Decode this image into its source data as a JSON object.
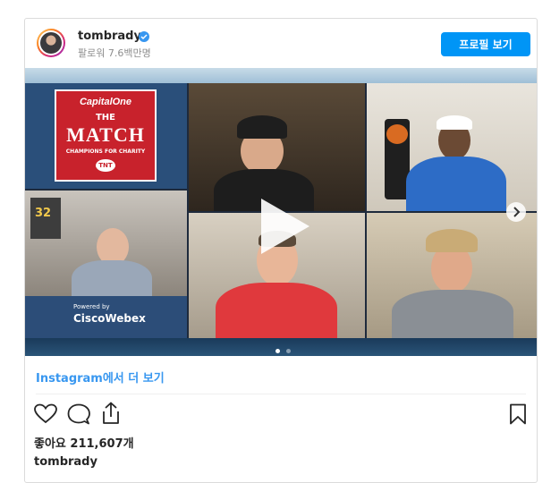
{
  "header": {
    "username": "tombrady",
    "followers": "팔로워 7.6백만명",
    "profile_button": "프로필 보기"
  },
  "media": {
    "sponsor": "CapitalOne",
    "event_the": "THE",
    "event_title": "MATCH",
    "event_subtitle": "CHAMPIONS FOR CHARITY",
    "network": "TNT",
    "powered_by": "Powered by",
    "webex": "CiscoWebex",
    "jersey_number": "32"
  },
  "links": {
    "view_more": "Instagram에서 더 보기"
  },
  "footer": {
    "likes": "좋아요 211,607개",
    "caption_user": "tombrady"
  },
  "icons": [
    "verified-icon",
    "play-icon",
    "chevron-right-icon",
    "heart-icon",
    "comment-icon",
    "share-icon",
    "bookmark-icon"
  ],
  "colors": {
    "accent": "#0095f6",
    "link": "#3897f0",
    "verified": "#3897f0",
    "match_red": "#c8222c"
  }
}
